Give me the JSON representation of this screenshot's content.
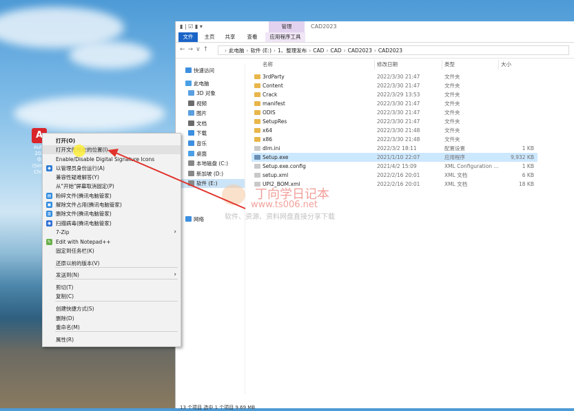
{
  "desktop": {
    "icon_glyph": "A",
    "icon_label_lines": [
      "Auto",
      "202",
      "中",
      "(Simp",
      "Chin"
    ]
  },
  "context_menu": {
    "items": [
      {
        "label": "打开(O)",
        "bold": true
      },
      {
        "label": "打开文件所在的位置(I)",
        "highlight": true
      },
      {
        "label": "Enable/Disable Digital Signature Icons"
      },
      {
        "label": "以管理员身份运行(A)",
        "icon": "shield-icon"
      },
      {
        "label": "兼容性疑难解答(Y)"
      },
      {
        "label": "从\"开始\"屏幕取消固定(P)"
      },
      {
        "label": "粉碎文件(腾讯电脑管家)",
        "icon": "shred-icon"
      },
      {
        "label": "解除文件占用(腾讯电脑管家)",
        "icon": "unlock-icon"
      },
      {
        "label": "删除文件(腾讯电脑管家)",
        "icon": "delete-icon"
      },
      {
        "label": "扫描病毒(腾讯电脑管家)",
        "icon": "scan-icon"
      },
      {
        "label": "7-Zip",
        "submenu": true
      },
      {
        "label": "Edit with Notepad++",
        "icon": "notepad-icon"
      },
      {
        "label": "固定到任务栏(K)"
      },
      {
        "label": "还原以前的版本(V)"
      },
      {
        "label": "发送到(N)",
        "submenu": true
      },
      {
        "label": "剪切(T)"
      },
      {
        "label": "复制(C)"
      },
      {
        "label": "创建快捷方式(S)"
      },
      {
        "label": "删除(D)"
      },
      {
        "label": "重命名(M)"
      },
      {
        "label": "属性(R)"
      }
    ]
  },
  "explorer": {
    "title": "CAD2023",
    "context_tab": "管理",
    "ribbon_tabs": [
      "文件",
      "主页",
      "共享",
      "查看",
      "应用程序工具"
    ],
    "breadcrumb": [
      "此电脑",
      "软件 (E:)",
      "1、整理发布",
      "CAD",
      "CAD",
      "CAD2023",
      "CAD2023"
    ],
    "nav": {
      "quick_access": "快速访问",
      "this_pc": "此电脑",
      "items": [
        "3D 对象",
        "视频",
        "图片",
        "文档",
        "下载",
        "音乐",
        "桌面",
        "本地磁盘 (C:)",
        "新加坡 (D:)",
        "软件 (E:)"
      ],
      "network": "网络"
    },
    "columns": [
      "名称",
      "修改日期",
      "类型",
      "大小"
    ],
    "files": [
      {
        "name": "3rdParty",
        "date": "2022/3/30 21:47",
        "type": "文件夹",
        "size": "",
        "kind": "folder"
      },
      {
        "name": "Content",
        "date": "2022/3/30 21:47",
        "type": "文件夹",
        "size": "",
        "kind": "folder"
      },
      {
        "name": "Crack",
        "date": "2022/3/29 13:53",
        "type": "文件夹",
        "size": "",
        "kind": "folder"
      },
      {
        "name": "manifest",
        "date": "2022/3/30 21:47",
        "type": "文件夹",
        "size": "",
        "kind": "folder"
      },
      {
        "name": "ODIS",
        "date": "2022/3/30 21:47",
        "type": "文件夹",
        "size": "",
        "kind": "folder"
      },
      {
        "name": "SetupRes",
        "date": "2022/3/30 21:47",
        "type": "文件夹",
        "size": "",
        "kind": "folder"
      },
      {
        "name": "x64",
        "date": "2022/3/30 21:48",
        "type": "文件夹",
        "size": "",
        "kind": "folder"
      },
      {
        "name": "x86",
        "date": "2022/3/30 21:48",
        "type": "文件夹",
        "size": "",
        "kind": "folder"
      },
      {
        "name": "dlm.ini",
        "date": "2022/3/2 18:11",
        "type": "配置设置",
        "size": "1 KB",
        "kind": "file"
      },
      {
        "name": "Setup.exe",
        "date": "2021/1/10 22:07",
        "type": "应用程序",
        "size": "9,932 KB",
        "kind": "exe",
        "selected": true
      },
      {
        "name": "Setup.exe.config",
        "date": "2021/4/2 15:09",
        "type": "XML Configuration ...",
        "size": "1 KB",
        "kind": "file"
      },
      {
        "name": "setup.xml",
        "date": "2022/2/16 20:01",
        "type": "XML 文档",
        "size": "6 KB",
        "kind": "file"
      },
      {
        "name": "UPI2_BOM.xml",
        "date": "2022/2/16 20:01",
        "type": "XML 文档",
        "size": "18 KB",
        "kind": "file"
      }
    ],
    "status": "13 个项目    选中 1 个项目 9.69 MB"
  },
  "watermark": {
    "title": "丁向学日记本",
    "url": "www.ts006.net",
    "slogan": "软件、资源、资料网盘直接分享下载"
  },
  "colors": {
    "ribbon_file": "#1a64c8",
    "selection": "#cce8ff",
    "folder": "#e8b64a",
    "arrow": "#e0322b"
  }
}
